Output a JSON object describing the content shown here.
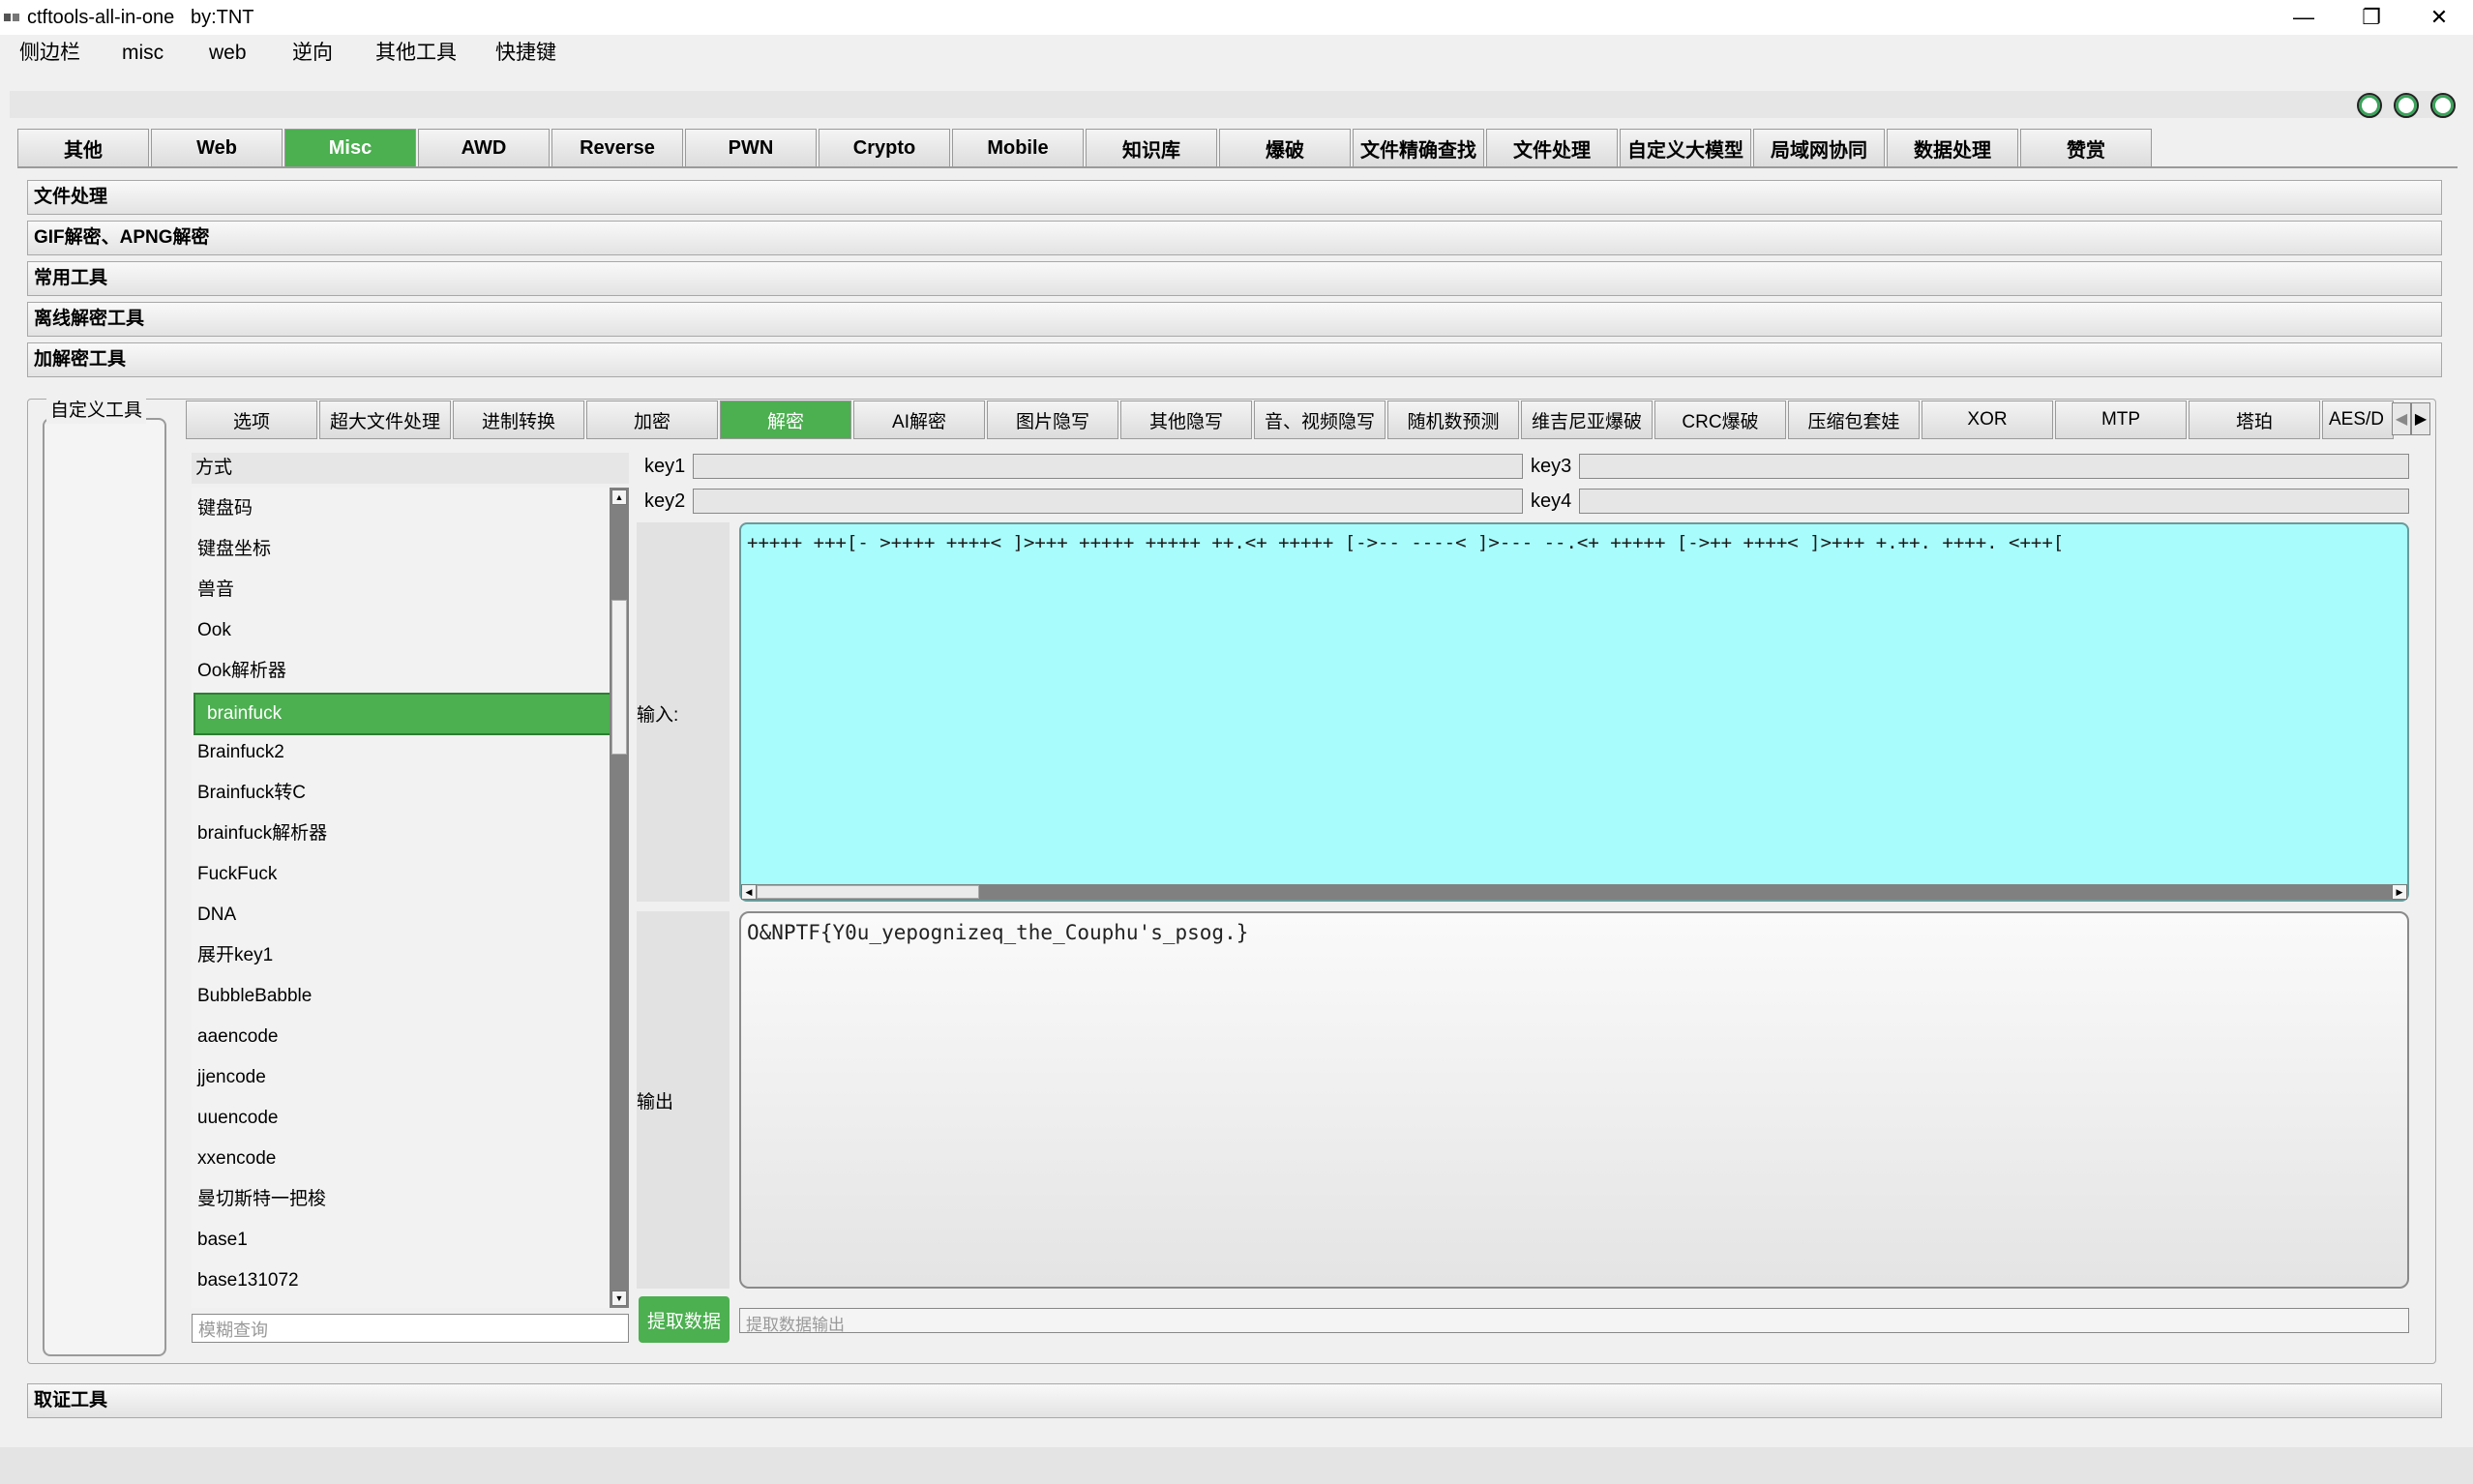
{
  "window": {
    "title": "ctftools-all-in-one   by:TNT",
    "controls": {
      "minimize": "—",
      "restore": "❐",
      "close": "✕"
    }
  },
  "menu": [
    "侧边栏",
    "misc",
    "web",
    "逆向",
    "其他工具",
    "快捷键"
  ],
  "main_tabs": {
    "items": [
      "其他",
      "Web",
      "Misc",
      "AWD",
      "Reverse",
      "PWN",
      "Crypto",
      "Mobile",
      "知识库",
      "爆破",
      "文件精确查找",
      "文件处理",
      "自定义大模型",
      "局域网协同",
      "数据处理",
      "赞赏"
    ],
    "active": "Misc"
  },
  "sections": {
    "file_processing": "文件处理",
    "gif_apng": "GIF解密、APNG解密",
    "common_tools": "常用工具",
    "offline_decrypt": "离线解密工具",
    "encrypt_decrypt": "加解密工具",
    "forensics": "取证工具"
  },
  "custom_tool_label": "自定义工具",
  "sub_tabs": {
    "items": [
      "选项",
      "超大文件处理",
      "进制转换",
      "加密",
      "解密",
      "AI解密",
      "图片隐写",
      "其他隐写",
      "音、视频隐写",
      "随机数预测",
      "维吉尼亚爆破",
      "CRC爆破",
      "压缩包套娃",
      "XOR",
      "MTP",
      "塔珀",
      "AES/D"
    ],
    "active": "解密"
  },
  "method": {
    "header": "方式",
    "items": [
      "键盘码",
      "键盘坐标",
      "兽音",
      "Ook",
      "Ook解析器",
      "brainfuck",
      "Brainfuck2",
      "Brainfuck转C",
      "brainfuck解析器",
      "FuckFuck",
      "DNA",
      "展开key1",
      "BubbleBabble",
      "aaencode",
      "jjencode",
      "uuencode",
      "xxencode",
      "曼切斯特一把梭",
      "base1",
      "base131072"
    ],
    "selected": "brainfuck",
    "search_placeholder": "模糊查询"
  },
  "keys": {
    "key1": "key1",
    "key2": "key2",
    "key3": "key3",
    "key4": "key4"
  },
  "input": {
    "label": "输入:",
    "value": "+++++ +++[- >++++ ++++< ]>+++ +++++ +++++ ++.<+ +++++ [->-- ----< ]>--- --.<+ +++++ [->++ ++++< ]>+++ +.++. ++++. <+++["
  },
  "output": {
    "label": "输出",
    "value": "O&NPTF{Y0u_yepognizeq_the_Couphu's_psog.}"
  },
  "extract": {
    "button": "提取数据",
    "placeholder": "提取数据输出"
  },
  "colors": {
    "accent_green": "#4caf50",
    "input_bg": "#a8fcfc"
  }
}
